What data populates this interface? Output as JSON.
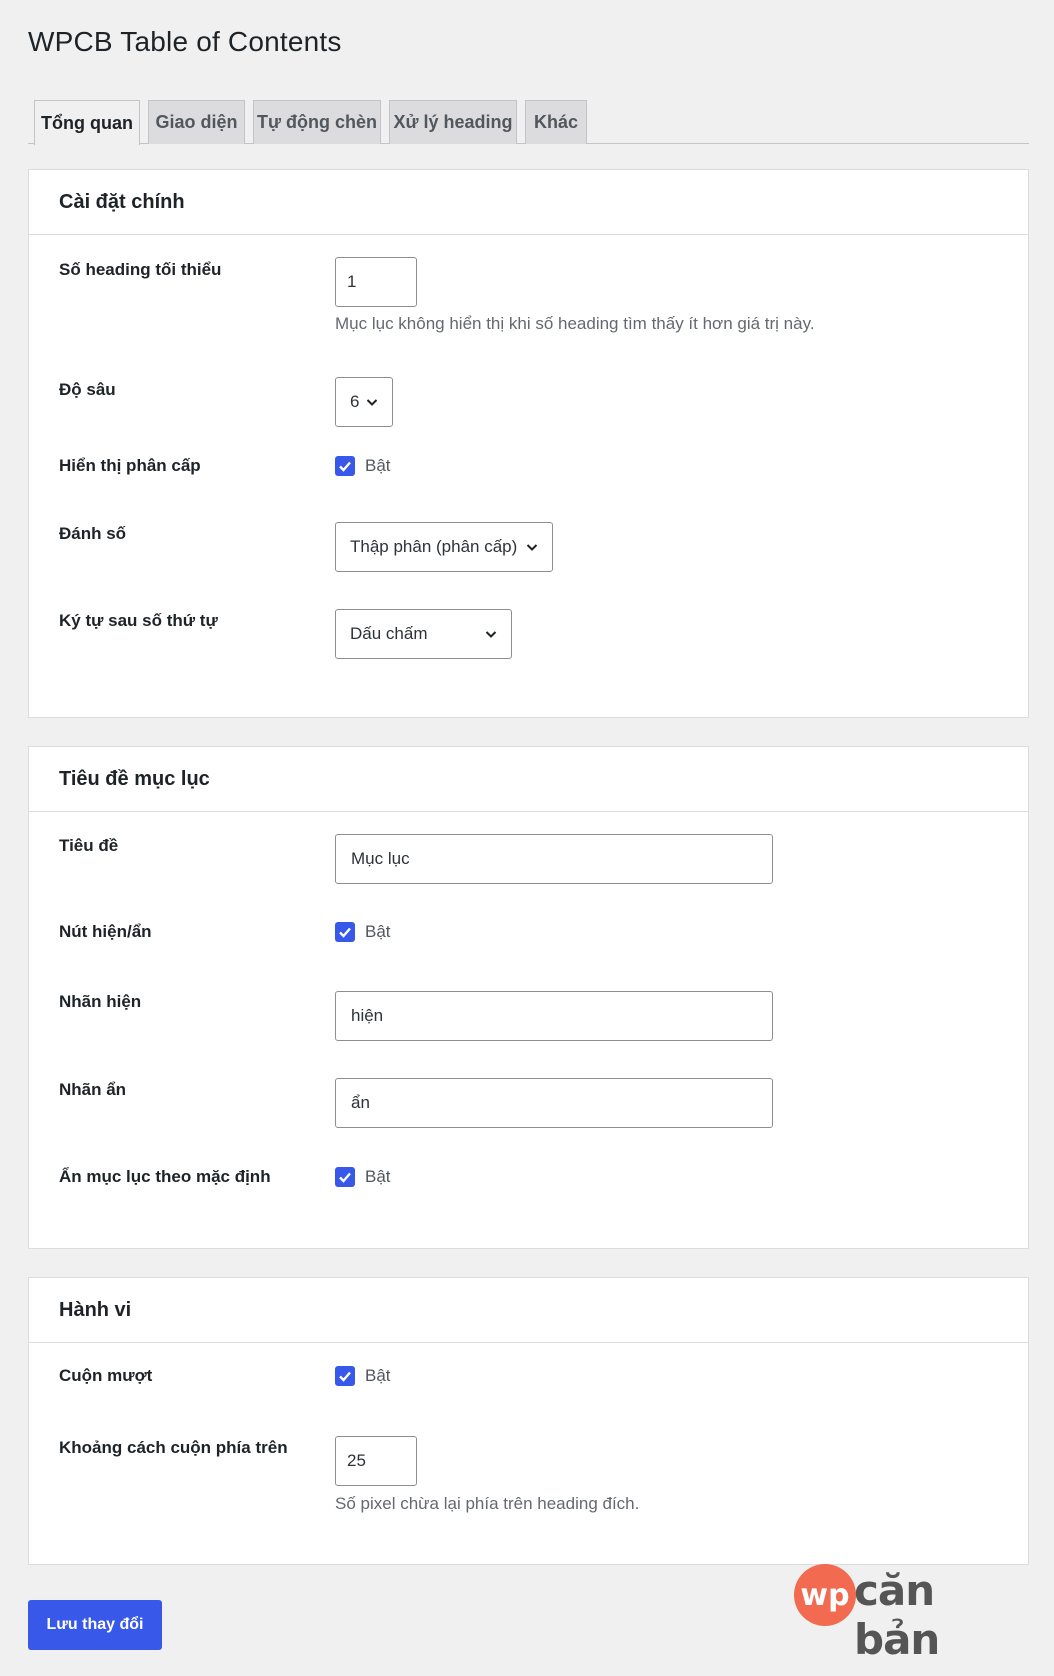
{
  "page": {
    "title": "WPCB Table of Contents"
  },
  "tabs": [
    {
      "label": "Tổng quan",
      "active": true
    },
    {
      "label": "Giao diện",
      "active": false
    },
    {
      "label": "Tự động chèn",
      "active": false
    },
    {
      "label": "Xử lý heading",
      "active": false
    },
    {
      "label": "Khác",
      "active": false
    }
  ],
  "main_settings": {
    "title": "Cài đặt chính",
    "min_headings": {
      "label": "Số heading tối thiểu",
      "value": "1",
      "description": "Mục lục không hiển thị khi số heading tìm thấy ít hơn giá trị này."
    },
    "depth": {
      "label": "Độ sâu",
      "value": "6"
    },
    "hierarchy": {
      "label": "Hiển thị phân cấp",
      "checked": true,
      "option": "Bật"
    },
    "numbering": {
      "label": "Đánh số",
      "value": "Thập phân (phân cấp)"
    },
    "suffix": {
      "label": "Ký tự sau số thứ tự",
      "value": "Dấu chấm"
    }
  },
  "toc_title": {
    "title": "Tiêu đề mục lục",
    "heading": {
      "label": "Tiêu đề",
      "value": "Mục lục"
    },
    "toggle_button": {
      "label": "Nút hiện/ẩn",
      "checked": true,
      "option": "Bật"
    },
    "show_label": {
      "label": "Nhãn hiện",
      "value": "hiện"
    },
    "hide_label": {
      "label": "Nhãn ẩn",
      "value": "ẩn"
    },
    "hide_default": {
      "label": "Ẩn mục lục theo mặc định",
      "checked": true,
      "option": "Bật"
    }
  },
  "behavior": {
    "title": "Hành vi",
    "smooth_scroll": {
      "label": "Cuộn mượt",
      "checked": true,
      "option": "Bật"
    },
    "scroll_offset": {
      "label": "Khoảng cách cuộn phía trên",
      "value": "25",
      "description": "Số pixel chừa lại phía trên heading đích."
    }
  },
  "actions": {
    "save_label": "Lưu thay đổi"
  },
  "watermark": {
    "circle": "wp",
    "text": "căn bản"
  },
  "colors": {
    "accent": "#3858e9",
    "logo": "#f26a4f"
  }
}
